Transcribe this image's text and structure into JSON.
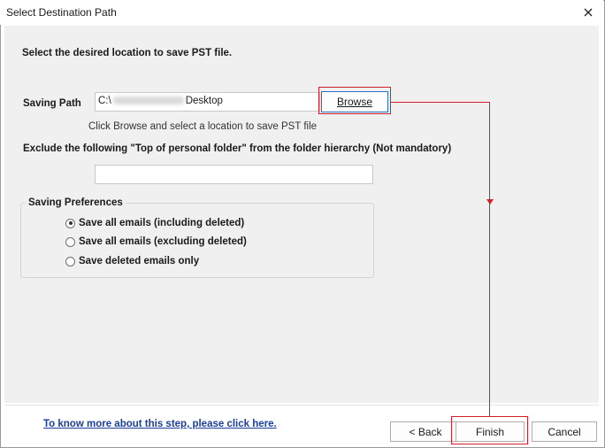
{
  "window": {
    "title": "Select Destination Path",
    "close_glyph": "×"
  },
  "heading": "Select the desired location to save PST file.",
  "saving_path": {
    "label": "Saving Path",
    "value_prefix": "C:\\",
    "value_suffix": "Desktop",
    "browse_label": "Browse",
    "hint": "Click Browse and select a location to save PST file"
  },
  "exclude": {
    "label": "Exclude the following \"Top of personal folder\" from the folder hierarchy  (Not mandatory)",
    "value": ""
  },
  "preferences": {
    "title": "Saving Preferences",
    "options": [
      {
        "label": "Save all emails (including deleted)",
        "selected": true
      },
      {
        "label": "Save all emails (excluding deleted)",
        "selected": false
      },
      {
        "label": "Save deleted emails only",
        "selected": false
      }
    ]
  },
  "footer": {
    "help_link": "To know more about this step, please click here.",
    "back_label": "Back",
    "finish_label": "Finish",
    "cancel_label": "Cancel"
  },
  "colors": {
    "annotation": "#d21f2d",
    "link": "#1a3e9c",
    "panel": "#f0f0f0"
  },
  "icons": {
    "close": "close-icon",
    "annotation_arrow": "arrow-down-icon"
  }
}
